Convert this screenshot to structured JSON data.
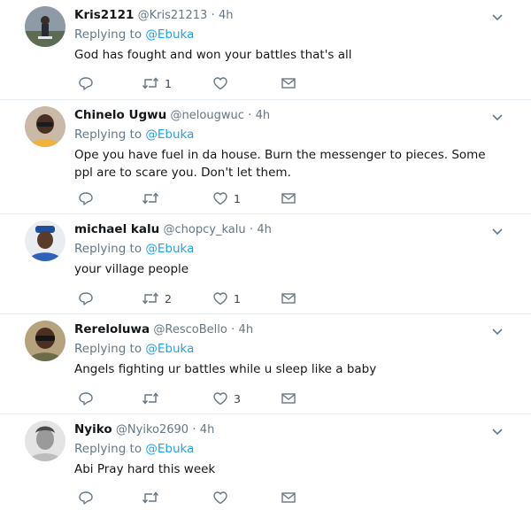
{
  "reply_prefix": "Replying to",
  "tweets": [
    {
      "name": "Kris2121",
      "handle": "@Kris21213",
      "time": "4h",
      "replying_to": "@Ebuka",
      "text": "God has fought and won your battles that's all",
      "retweets": "1",
      "likes": ""
    },
    {
      "name": "Chinelo Ugwu",
      "handle": "@nelougwuc",
      "time": "4h",
      "replying_to": "@Ebuka",
      "text": "Ope you have fuel in da house.  Burn the messenger to pieces. Some ppl are to scare you. Don't let them.",
      "retweets": "",
      "likes": "1"
    },
    {
      "name": "michael kalu",
      "handle": "@chopcy_kalu",
      "time": "4h",
      "replying_to": "@Ebuka",
      "text": "your village people",
      "retweets": "2",
      "likes": "1"
    },
    {
      "name": "Rereloluwa",
      "handle": "@RescoBello",
      "time": "4h",
      "replying_to": "@Ebuka",
      "text": "Angels fighting ur battles while u sleep like a baby",
      "retweets": "",
      "likes": "3"
    },
    {
      "name": "Nyiko",
      "handle": "@Nyiko2690",
      "time": "4h",
      "replying_to": "@Ebuka",
      "text": "Abi  Pray  hard this week",
      "retweets": "",
      "likes": ""
    }
  ],
  "separator": "·",
  "icons": {
    "reply": "reply-icon",
    "retweet": "retweet-icon",
    "like": "heart-icon",
    "dm": "envelope-icon",
    "more": "chevron-down-icon"
  },
  "colors": {
    "link": "#1da1f2",
    "muted": "#657786",
    "divider": "#e6ecf0"
  }
}
